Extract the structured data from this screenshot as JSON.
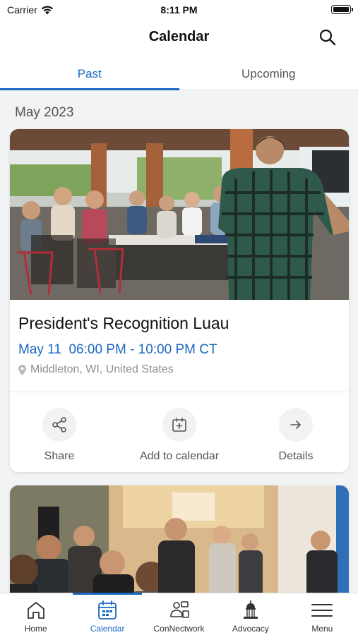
{
  "status_bar": {
    "carrier": "Carrier",
    "time": "8:11 PM"
  },
  "header": {
    "title": "Calendar"
  },
  "tabs": [
    {
      "label": "Past",
      "active": true
    },
    {
      "label": "Upcoming",
      "active": false
    }
  ],
  "section": {
    "title": "May 2023"
  },
  "events": [
    {
      "title": "President's Recognition Luau",
      "date": "May 11",
      "time": "06:00 PM - 10:00 PM CT",
      "location": "Middleton, WI, United States",
      "actions": [
        {
          "label": "Share",
          "icon": "share-icon"
        },
        {
          "label": "Add to calendar",
          "icon": "calendar-add-icon"
        },
        {
          "label": "Details",
          "icon": "arrow-right-icon"
        }
      ]
    }
  ],
  "bottom_nav": [
    {
      "label": "Home",
      "icon": "home-icon",
      "active": false
    },
    {
      "label": "Calendar",
      "icon": "calendar-icon",
      "active": true
    },
    {
      "label": "ConNectwork",
      "icon": "network-icon",
      "active": false
    },
    {
      "label": "Advocacy",
      "icon": "capitol-icon",
      "active": false
    },
    {
      "label": "Menu",
      "icon": "menu-icon",
      "active": false
    }
  ],
  "colors": {
    "accent": "#1b68c4",
    "background": "#f2f3f5",
    "muted_text": "#8c8f94"
  }
}
